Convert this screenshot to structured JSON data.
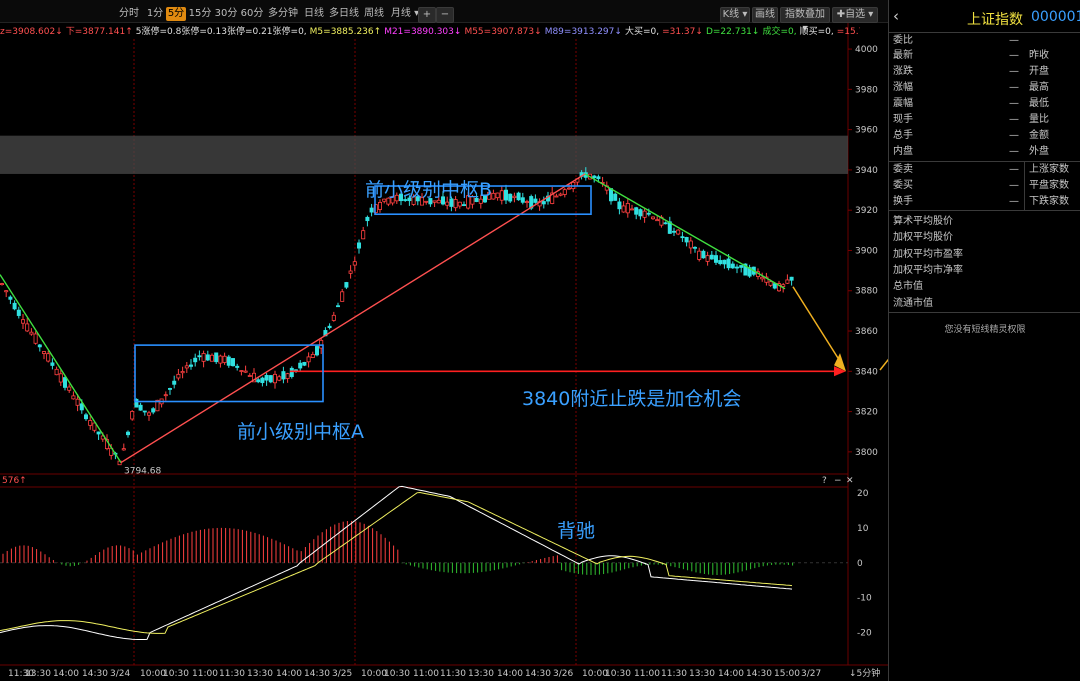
{
  "toolbar": {
    "periods": [
      "分时",
      "1分",
      "5分",
      "15分",
      "30分",
      "60分",
      "多分钟",
      "日线",
      "多日线",
      "周线",
      "月线 ▾"
    ],
    "selected": "5分",
    "plus": "+",
    "minus": "−",
    "right_buttons": [
      "K线 ▾",
      "画线",
      "指数叠加 ▾",
      "✚自选 ▾"
    ]
  },
  "indicators": [
    {
      "text": "z=3908.602↓",
      "color": "#ff5050"
    },
    {
      "text": "下=3877.141↑",
      "color": "#ff5050"
    },
    {
      "text": "5涨停=0.8张停=0.13张停=0.21张停=0,",
      "color": "#e0e0e0"
    },
    {
      "text": "M5=3885.236↑",
      "color": "#f0f060"
    },
    {
      "text": "M21=3890.303↓",
      "color": "#ff40ff"
    },
    {
      "text": "M55=3907.873↓",
      "color": "#ff5050"
    },
    {
      "text": "M89=3913.297↓",
      "color": "#9090ff"
    },
    {
      "text": "大买=0,",
      "color": "#e0e0e0"
    },
    {
      "text": "=31.37↓",
      "color": "#ff5050"
    },
    {
      "text": "D=22.731↓",
      "color": "#40e040"
    },
    {
      "text": "成交=0,",
      "color": "#40e040"
    },
    {
      "text": "顺买=0,",
      "color": "#e0e0e0"
    },
    {
      "text": "=15.73↓",
      "color": "#ff5050"
    },
    {
      "text": "小买=0,底背",
      "color": "#e0e0e0"
    }
  ],
  "price_axis": {
    "min": 3790,
    "max": 4005,
    "ticks": [
      "4000",
      "3980",
      "3960",
      "3940",
      "3920",
      "3900",
      "3880",
      "3860",
      "3840",
      "3820",
      "3800"
    ]
  },
  "macd_axis": {
    "label": "576↑",
    "ticks": [
      "20",
      "10",
      "0",
      "-10",
      "-20"
    ],
    "controls": [
      "?",
      "−",
      "✕"
    ]
  },
  "time_axis": [
    "11:30",
    "13:30",
    "14:00",
    "14:30",
    "3/24",
    "10:00",
    "10:30",
    "11:00",
    "11:30",
    "13:30",
    "14:00",
    "14:30",
    "3/25",
    "10:00",
    "10:30",
    "11:00",
    "11:30",
    "13:30",
    "14:00",
    "14:30",
    "3/26",
    "10:00",
    "10:30",
    "11:00",
    "11:30",
    "13:30",
    "14:00",
    "14:30",
    "15:00",
    "3/27"
  ],
  "period_indicator": "↓5分钟",
  "annotations": {
    "low_label": "3794.68",
    "zone_a": "前小级别中枢A",
    "zone_b": "前小级别中枢B",
    "support": "3840附近止跌是加仓机会",
    "divergence": "背驰"
  },
  "chart_data": {
    "type": "candlestick",
    "title": "上证指数 000001 5分",
    "low_marker": 3794.68,
    "zone_a": {
      "low": 3825,
      "high": 3853
    },
    "zone_b": {
      "low": 3918,
      "high": 3932
    },
    "support_level": 3840,
    "resistance_band": [
      3938,
      3957
    ],
    "trend_lines": [
      {
        "from": 3888,
        "to": 3794.68,
        "color": "#40e040"
      },
      {
        "from": 3794.68,
        "to": 3938,
        "color": "#ff5050"
      },
      {
        "from": 3938,
        "to": 3881,
        "color": "#40e040"
      }
    ],
    "macd_ylim": [
      -25,
      22
    ]
  },
  "side_panel": {
    "name": "上证指数",
    "code": "000001",
    "back_icon": "‹",
    "rows_left": [
      "委比",
      "最新",
      "涨跌",
      "涨幅",
      "震幅",
      "现手",
      "总手",
      "内盘",
      "委卖",
      "委买",
      "换手"
    ],
    "rows_right": [
      "",
      "昨收",
      "开盘",
      "最高",
      "最低",
      "量比",
      "金额",
      "外盘",
      "上涨家数",
      "平盘家数",
      "下跌家数"
    ],
    "dash": "—",
    "extra_rows": [
      "算术平均股价",
      "加权平均股价",
      "加权平均市盈率",
      "加权平均市净率",
      "总市值",
      "流通市值"
    ],
    "note": "您没有短线精灵权限"
  }
}
